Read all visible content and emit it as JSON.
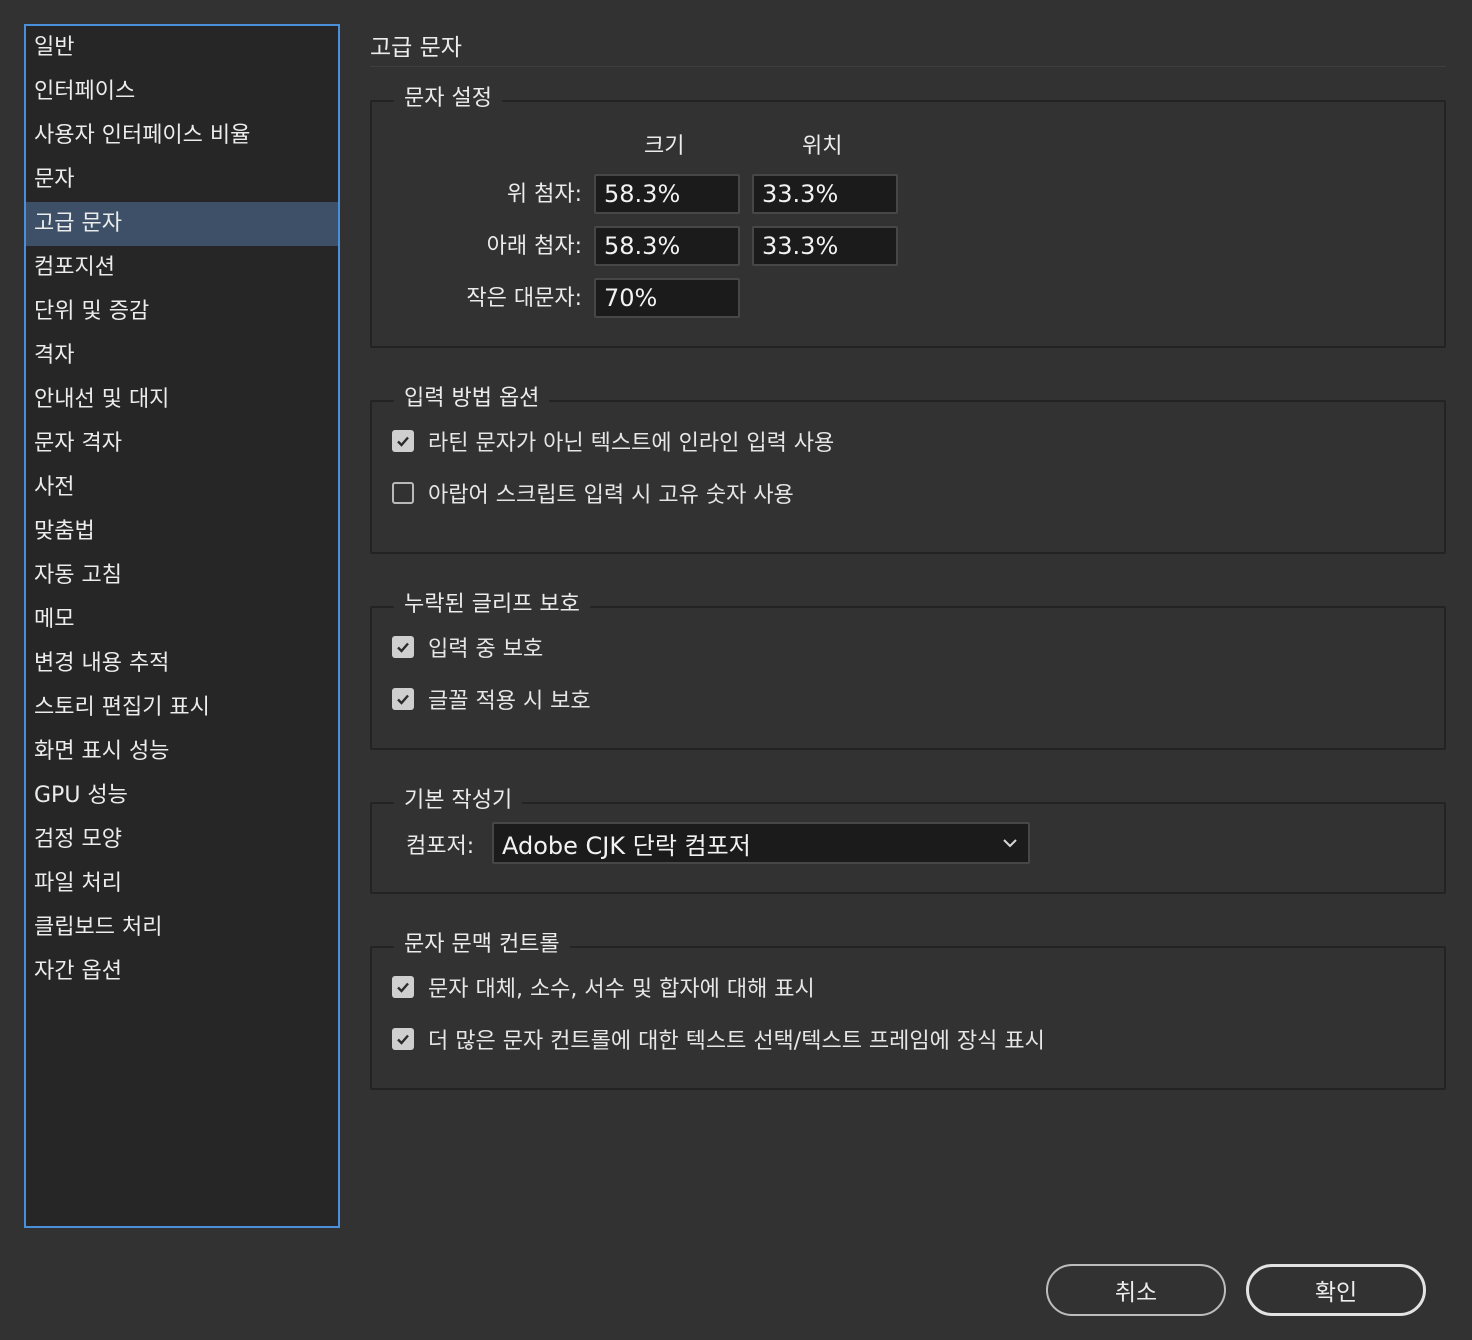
{
  "sidebar": {
    "items": [
      {
        "label": "일반"
      },
      {
        "label": "인터페이스"
      },
      {
        "label": "사용자 인터페이스 비율"
      },
      {
        "label": "문자"
      },
      {
        "label": "고급 문자",
        "selected": true
      },
      {
        "label": "컴포지션"
      },
      {
        "label": "단위 및 증감"
      },
      {
        "label": "격자"
      },
      {
        "label": "안내선 및 대지"
      },
      {
        "label": "문자 격자"
      },
      {
        "label": "사전"
      },
      {
        "label": "맞춤법"
      },
      {
        "label": "자동 고침"
      },
      {
        "label": "메모"
      },
      {
        "label": "변경 내용 추적"
      },
      {
        "label": "스토리 편집기 표시"
      },
      {
        "label": "화면 표시 성능"
      },
      {
        "label": "GPU 성능"
      },
      {
        "label": "검정 모양"
      },
      {
        "label": "파일 처리"
      },
      {
        "label": "클립보드 처리"
      },
      {
        "label": "자간 옵션"
      }
    ]
  },
  "page": {
    "title": "고급 문자"
  },
  "char_settings": {
    "legend": "문자 설정",
    "col_size": "크기",
    "col_position": "위치",
    "superscript": {
      "label": "위 첨자:",
      "size": "58.3%",
      "position": "33.3%"
    },
    "subscript": {
      "label": "아래 첨자:",
      "size": "58.3%",
      "position": "33.3%"
    },
    "small_caps": {
      "label": "작은 대문자:",
      "size": "70%"
    }
  },
  "input_method": {
    "legend": "입력 방법 옵션",
    "options": [
      {
        "label": "라틴 문자가 아닌 텍스트에 인라인 입력 사용",
        "checked": true
      },
      {
        "label": "아랍어 스크립트 입력 시 고유 숫자 사용",
        "checked": false
      }
    ]
  },
  "missing_glyph": {
    "legend": "누락된 글리프 보호",
    "options": [
      {
        "label": "입력 중 보호",
        "checked": true
      },
      {
        "label": "글꼴 적용 시 보호",
        "checked": true
      }
    ]
  },
  "default_composer": {
    "legend": "기본 작성기",
    "composer_label": "컴포저:",
    "composer_value": "Adobe CJK 단락 컴포저"
  },
  "context_controls": {
    "legend": "문자 문맥 컨트롤",
    "options": [
      {
        "label": "문자 대체, 소수, 서수 및 합자에 대해 표시",
        "checked": true
      },
      {
        "label": "더 많은 문자 컨트롤에 대한 텍스트 선택/텍스트 프레임에 장식 표시",
        "checked": true
      }
    ]
  },
  "buttons": {
    "cancel": "취소",
    "ok": "확인"
  },
  "colors": {
    "accent": "#4a8fd9",
    "selected_row": "#3d5068",
    "background": "#323232"
  }
}
